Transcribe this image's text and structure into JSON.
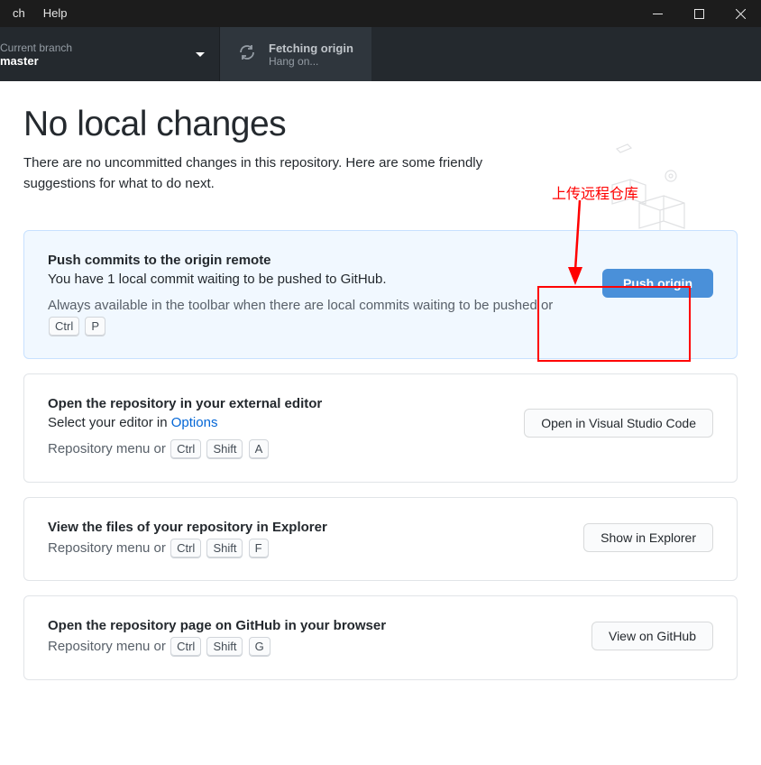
{
  "titlebar": {
    "menu": [
      "ch",
      "Help"
    ]
  },
  "toolbar": {
    "branch": {
      "label": "Current branch",
      "value": "master"
    },
    "fetch": {
      "label": "Fetching origin",
      "value": "Hang on..."
    }
  },
  "main": {
    "heading": "No local changes",
    "subheading": "There are no uncommitted changes in this repository. Here are some friendly suggestions for what to do next."
  },
  "cards": {
    "push": {
      "title": "Push commits to the origin remote",
      "desc": "You have 1 local commit waiting to be pushed to GitHub.",
      "hint_prefix": "Always available in the toolbar when there are local commits waiting to be pushed or ",
      "kbd": [
        "Ctrl",
        "P"
      ],
      "button": "Push origin"
    },
    "editor": {
      "title": "Open the repository in your external editor",
      "desc_prefix": "Select your editor in ",
      "desc_link": "Options",
      "hint_prefix": "Repository menu or ",
      "kbd": [
        "Ctrl",
        "Shift",
        "A"
      ],
      "button": "Open in Visual Studio Code"
    },
    "explorer": {
      "title": "View the files of your repository in Explorer",
      "hint_prefix": "Repository menu or ",
      "kbd": [
        "Ctrl",
        "Shift",
        "F"
      ],
      "button": "Show in Explorer"
    },
    "github": {
      "title": "Open the repository page on GitHub in your browser",
      "hint_prefix": "Repository menu or ",
      "kbd": [
        "Ctrl",
        "Shift",
        "G"
      ],
      "button": "View on GitHub"
    }
  },
  "annotation": {
    "text": "上传远程仓库"
  }
}
